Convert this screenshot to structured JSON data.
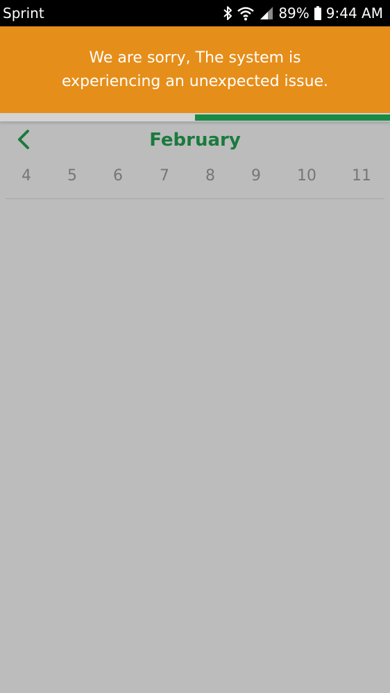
{
  "status_bar": {
    "carrier": "Sprint",
    "battery": "89%",
    "time": "9:44 AM",
    "icons": [
      "bluetooth-icon",
      "wifi-icon",
      "cell-signal-icon",
      "battery-icon"
    ]
  },
  "error_banner": {
    "line1": "We are sorry, The system is",
    "line2": "experiencing an unexpected issue.",
    "background_color": "#e68e1a"
  },
  "progress": {
    "fraction": 0.5,
    "fill_color": "#1a8a45"
  },
  "calendar": {
    "month": "February",
    "back_icon": "chevron-left-icon",
    "accent_color": "#1a7a3e",
    "days": [
      "4",
      "5",
      "6",
      "7",
      "8",
      "9",
      "10",
      "11"
    ]
  }
}
